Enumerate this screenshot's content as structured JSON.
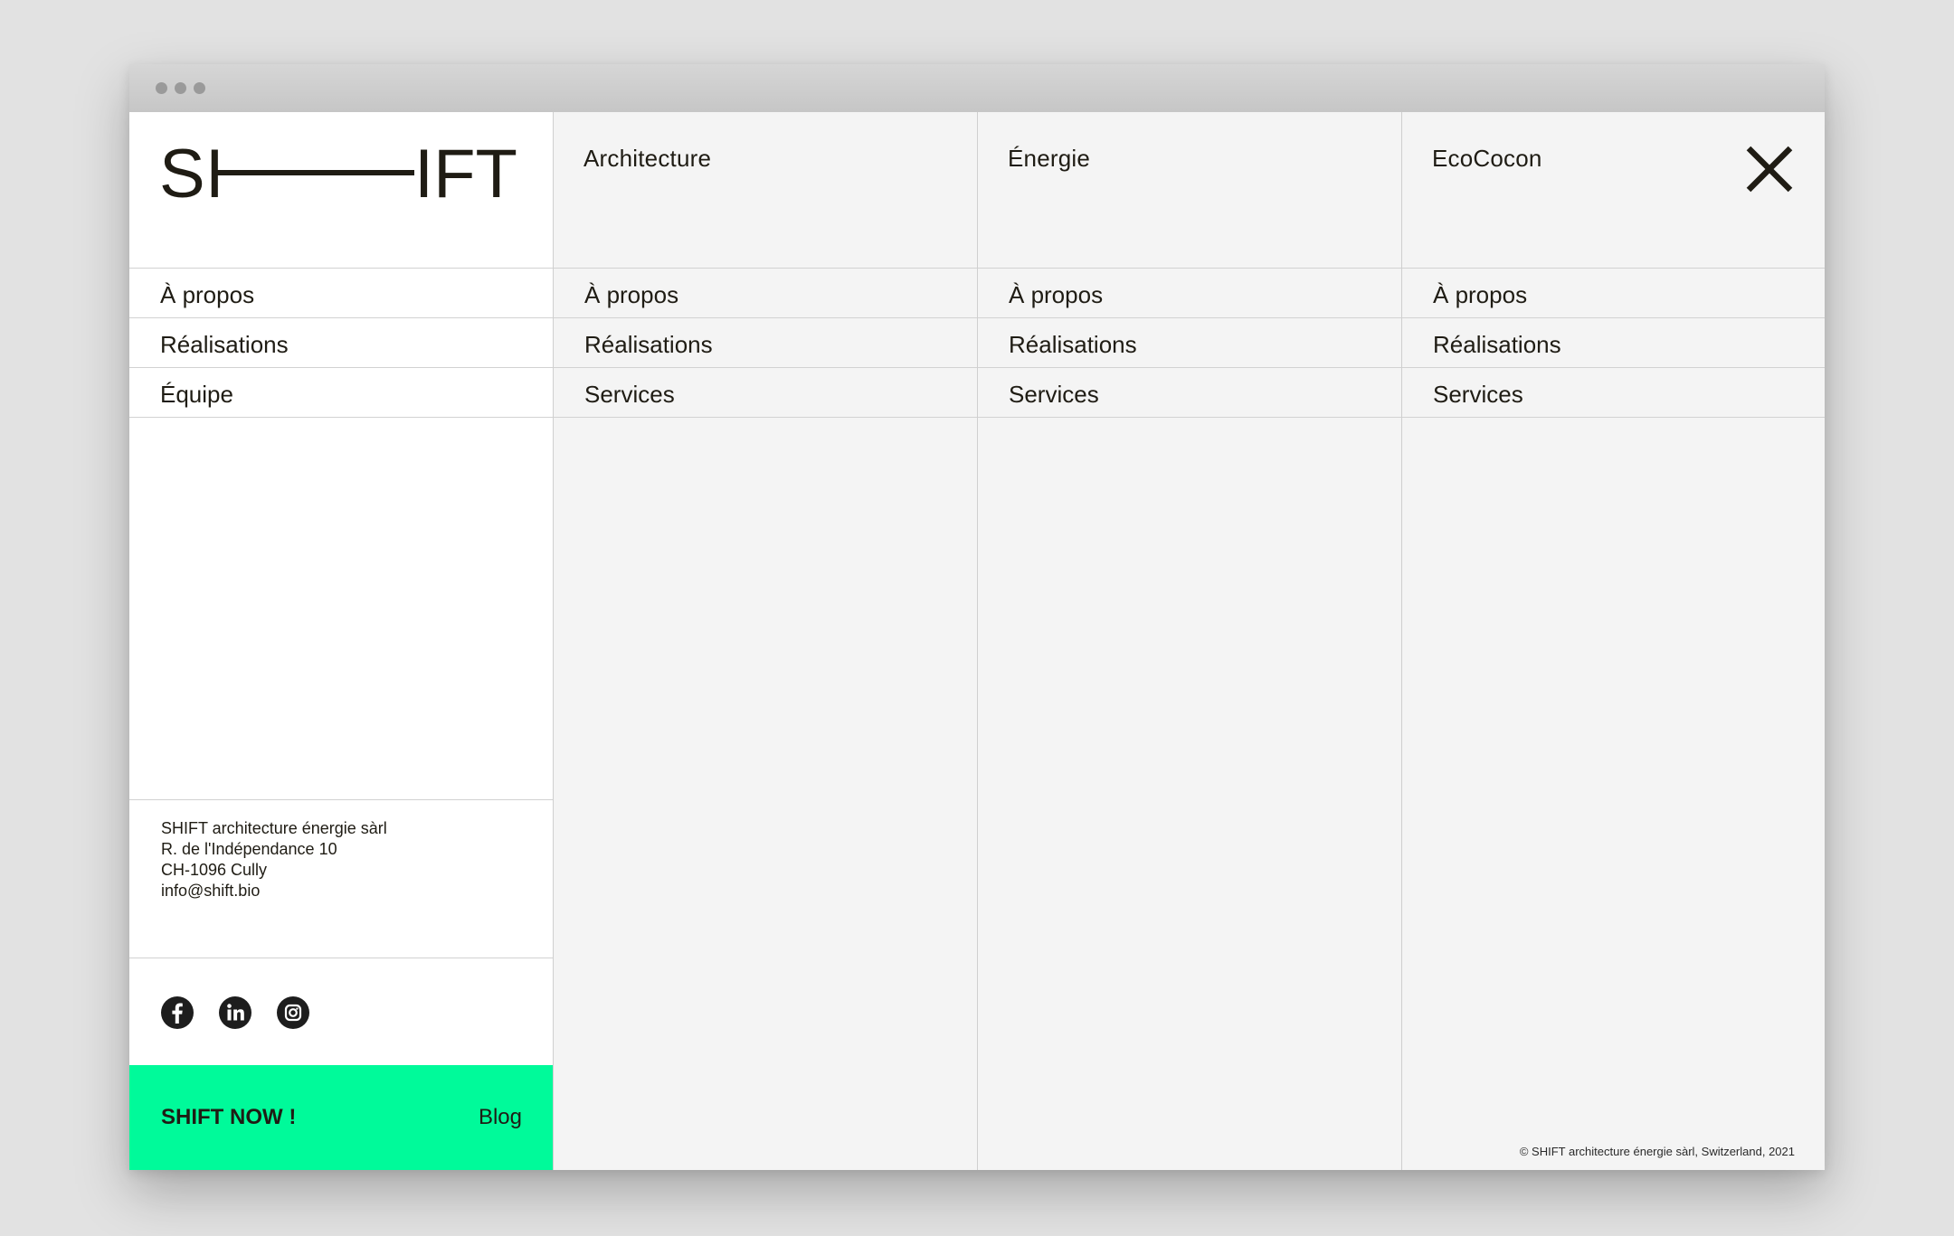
{
  "brand": {
    "logo_left": "SI",
    "logo_right": "IFT",
    "accent": "#00fa9a",
    "ink": "#1f1c14"
  },
  "sidebar": {
    "nav": [
      "À propos",
      "Réalisations",
      "Équipe"
    ],
    "address": [
      "SHIFT architecture énergie sàrl",
      "R. de l'Indépendance 10",
      "CH-1096 Cully",
      "info@shift.bio"
    ],
    "socials": [
      "facebook-icon",
      "linkedin-icon",
      "instagram-icon"
    ],
    "cta": {
      "now": "SHIFT NOW !",
      "blog": "Blog"
    }
  },
  "columns": [
    {
      "title": "Architecture",
      "items": [
        "À propos",
        "Réalisations",
        "Services"
      ]
    },
    {
      "title": "Énergie",
      "items": [
        "À propos",
        "Réalisations",
        "Services"
      ]
    },
    {
      "title": "EcoCocon",
      "items": [
        "À propos",
        "Réalisations",
        "Services"
      ]
    }
  ],
  "close": {
    "icon": "close-icon"
  },
  "footer": {
    "copyright": "© SHIFT  architecture énergie sàrl, Switzerland, 2021"
  }
}
